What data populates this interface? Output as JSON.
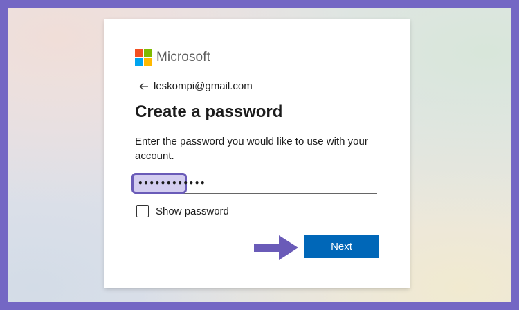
{
  "brand": {
    "name": "Microsoft",
    "colors": [
      "#f25022",
      "#7fba00",
      "#00a4ef",
      "#ffb900"
    ]
  },
  "identity": {
    "email": "leskompi@gmail.com",
    "back_icon": "arrow-left-icon"
  },
  "form": {
    "title": "Create a password",
    "description": "Enter the password you would like to use with your account.",
    "password_mask": "••••••••••••",
    "show_password_label": "Show password",
    "show_password_checked": false,
    "next_label": "Next"
  },
  "colors": {
    "accent": "#0067b8",
    "highlight": "#6a5bb8",
    "frame": "#7467c4"
  }
}
